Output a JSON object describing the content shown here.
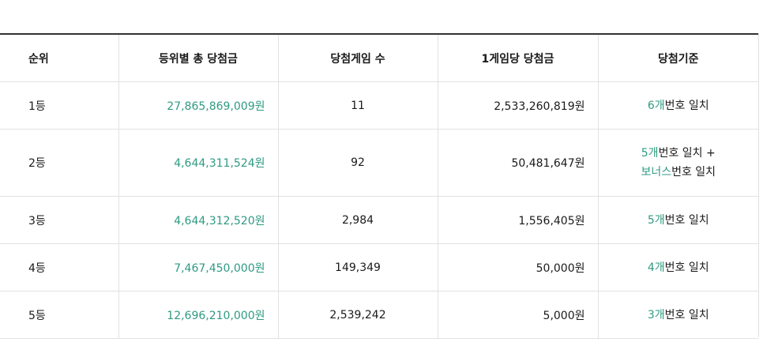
{
  "table": {
    "headers": [
      "순위",
      "등위별 총 당첨금",
      "당첨게임 수",
      "1게임당 당첨금",
      "당첨기준"
    ],
    "rows": [
      {
        "rank": "1등",
        "total": "27,865,869,009원",
        "count": "11",
        "per_game": "2,533,260,819원",
        "criteria": [
          {
            "accent": "6개",
            "text": "번호 일치"
          }
        ]
      },
      {
        "rank": "2등",
        "total": "4,644,311,524원",
        "count": "92",
        "per_game": "50,481,647원",
        "criteria": [
          {
            "accent": "5개",
            "text": "번호 일치 +"
          },
          {
            "accent": "보너스",
            "text": "번호 일치"
          }
        ]
      },
      {
        "rank": "3등",
        "total": "4,644,312,520원",
        "count": "2,984",
        "per_game": "1,556,405원",
        "criteria": [
          {
            "accent": "5개",
            "text": "번호 일치"
          }
        ]
      },
      {
        "rank": "4등",
        "total": "7,467,450,000원",
        "count": "149,349",
        "per_game": "50,000원",
        "criteria": [
          {
            "accent": "4개",
            "text": "번호 일치"
          }
        ]
      },
      {
        "rank": "5등",
        "total": "12,696,210,000원",
        "count": "2,539,242",
        "per_game": "5,000원",
        "criteria": [
          {
            "accent": "3개",
            "text": "번호 일치"
          }
        ]
      }
    ]
  },
  "colors": {
    "accent": "#2f9a82",
    "header_border": "#333333",
    "grid": "#e2e2e2"
  }
}
